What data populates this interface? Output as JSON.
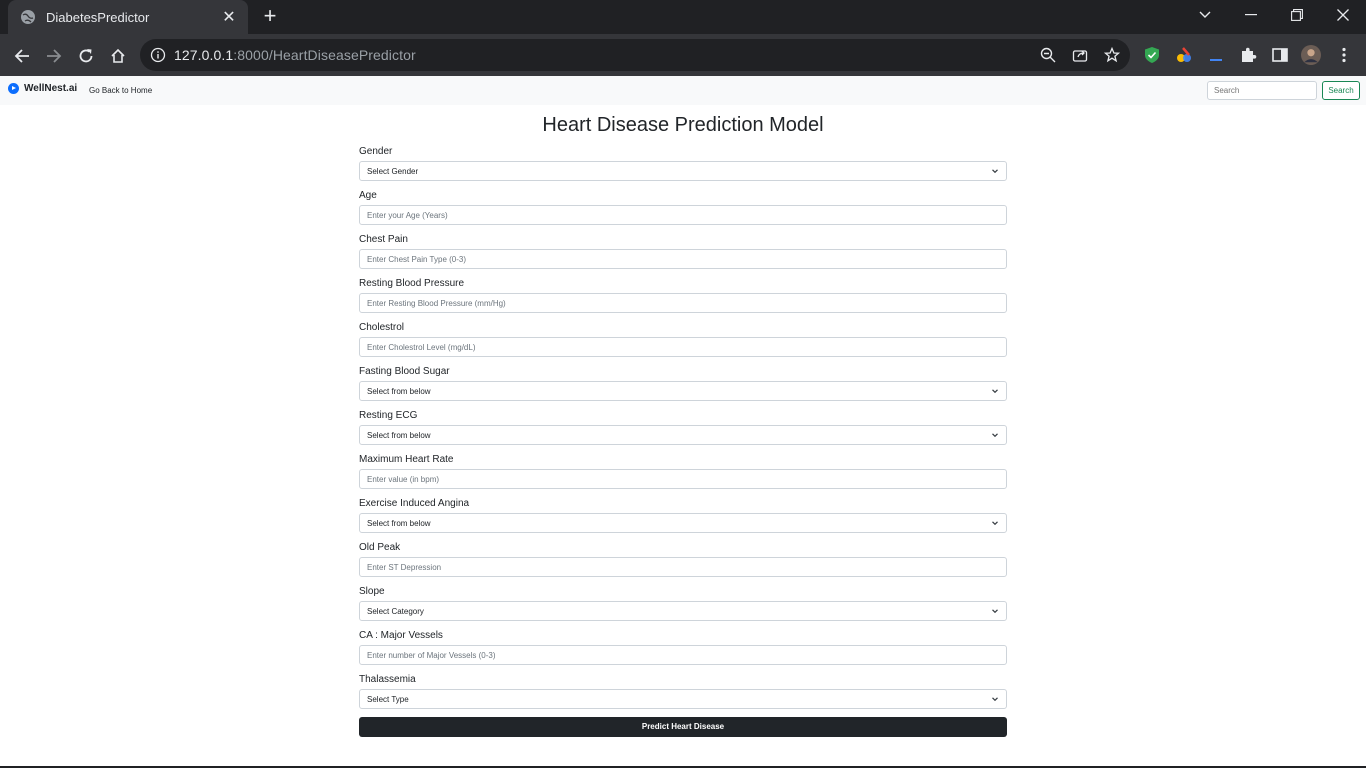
{
  "browser": {
    "tab_title": "DiabetesPredictor",
    "url_host": "127.0.0.1",
    "url_path": ":8000/HeartDiseasePredictor"
  },
  "navbar": {
    "brand": "WellNest.ai",
    "home_link": "Go Back to Home",
    "search_placeholder": "Search",
    "search_button": "Search"
  },
  "form": {
    "title": "Heart Disease Prediction Model",
    "fields": [
      {
        "label": "Gender",
        "type": "select",
        "value": "Select Gender"
      },
      {
        "label": "Age",
        "type": "input",
        "placeholder": "Enter your Age (Years)"
      },
      {
        "label": "Chest Pain",
        "type": "input",
        "placeholder": "Enter Chest Pain Type (0-3)"
      },
      {
        "label": "Resting Blood Pressure",
        "type": "input",
        "placeholder": "Enter Resting Blood Pressure (mm/Hg)"
      },
      {
        "label": "Cholestrol",
        "type": "input",
        "placeholder": "Enter Cholestrol Level (mg/dL)"
      },
      {
        "label": "Fasting Blood Sugar",
        "type": "select",
        "value": "Select from below"
      },
      {
        "label": "Resting ECG",
        "type": "select",
        "value": "Select from below"
      },
      {
        "label": "Maximum Heart Rate",
        "type": "input",
        "placeholder": "Enter value (in bpm)"
      },
      {
        "label": "Exercise Induced Angina",
        "type": "select",
        "value": "Select from below"
      },
      {
        "label": "Old Peak",
        "type": "input",
        "placeholder": "Enter ST Depression"
      },
      {
        "label": "Slope",
        "type": "select",
        "value": "Select Category"
      },
      {
        "label": "CA : Major Vessels",
        "type": "input",
        "placeholder": "Enter number of Major Vessels (0-3)"
      },
      {
        "label": "Thalassemia",
        "type": "select",
        "value": "Select Type"
      }
    ],
    "submit_label": "Predict Heart Disease"
  },
  "icons": {
    "favicon": "globe-icon",
    "accent_color": "#0d6efd",
    "button_dark": "#212529",
    "search_green": "#198754"
  }
}
